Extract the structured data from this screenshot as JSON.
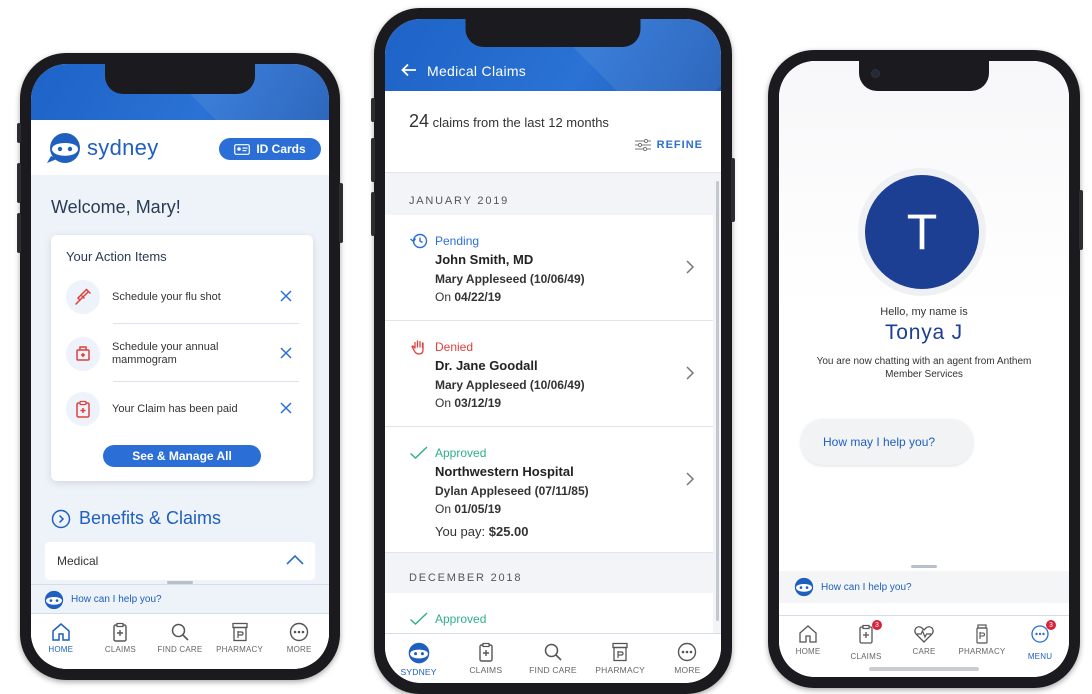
{
  "colors": {
    "brand_blue": "#2b6fd6",
    "navy": "#1c3f93",
    "denied_red": "#e0403a",
    "approved_green": "#2fae8c",
    "pending_blue": "#2b6fd6"
  },
  "phone1": {
    "logo_text": "sydney",
    "id_cards_label": "ID Cards",
    "welcome": "Welcome, Mary!",
    "action_items": {
      "title": "Your Action Items",
      "items": [
        {
          "text": "Schedule your flu shot",
          "icon": "syringe-icon"
        },
        {
          "text": "Schedule your annual mammogram",
          "icon": "mammogram-icon"
        },
        {
          "text": "Your Claim has been paid",
          "icon": "claim-clipboard-icon"
        }
      ],
      "manage_label": "See & Manage All"
    },
    "benefits_label": "Benefits & Claims",
    "medical_label": "Medical",
    "help_text": "How can I help you?",
    "tabs": [
      {
        "label": "HOME",
        "icon": "home-icon",
        "active": true
      },
      {
        "label": "CLAIMS",
        "icon": "clipboard-icon"
      },
      {
        "label": "FIND CARE",
        "icon": "search-icon"
      },
      {
        "label": "PHARMACY",
        "icon": "pharmacy-icon"
      },
      {
        "label": "MORE",
        "icon": "more-icon"
      }
    ]
  },
  "phone2": {
    "title": "Medical Claims",
    "claim_count": "24",
    "claim_count_suffix": " claims from the last 12 months",
    "refine_label": "REFINE",
    "months": [
      "JANUARY 2019",
      "DECEMBER 2018"
    ],
    "claims": [
      {
        "status": "Pending",
        "provider": "John Smith, MD",
        "patient": "Mary Appleseed (10/06/49)",
        "date_prefix": "On ",
        "date": "04/22/19"
      },
      {
        "status": "Denied",
        "provider": "Dr. Jane Goodall",
        "patient": "Mary Appleseed (10/06/49)",
        "date_prefix": "On ",
        "date": "03/12/19"
      },
      {
        "status": "Approved",
        "provider": "Northwestern Hospital",
        "patient": "Dylan Appleseed (07/11/85)",
        "date_prefix": "On ",
        "date": "01/05/19",
        "pay_prefix": "You pay: ",
        "pay_amount": "$25.00"
      }
    ],
    "next_status": "Approved",
    "tabs": [
      {
        "label": "SYDNEY",
        "icon": "sydney-icon",
        "active": true
      },
      {
        "label": "CLAIMS",
        "icon": "clipboard-icon"
      },
      {
        "label": "FIND CARE",
        "icon": "search-icon"
      },
      {
        "label": "PHARMACY",
        "icon": "pharmacy-icon"
      },
      {
        "label": "MORE",
        "icon": "more-icon"
      }
    ]
  },
  "phone3": {
    "avatar_letter": "T",
    "hello": "Hello, my name is",
    "agent_name": "Tonya J",
    "chat_note": "You are now chatting with an agent from Anthem Member Services",
    "bubble_text": "How may I help you?",
    "help_text": "How can I help you?",
    "tabs": [
      {
        "label": "HOME",
        "icon": "home-icon"
      },
      {
        "label": "CLAIMS",
        "icon": "clipboard-icon",
        "badge": "3"
      },
      {
        "label": "CARE",
        "icon": "heart-pulse-icon"
      },
      {
        "label": "PHARMACY",
        "icon": "pharmacy-icon"
      },
      {
        "label": "MENU",
        "icon": "more-icon",
        "badge": "3",
        "active": true
      }
    ]
  }
}
